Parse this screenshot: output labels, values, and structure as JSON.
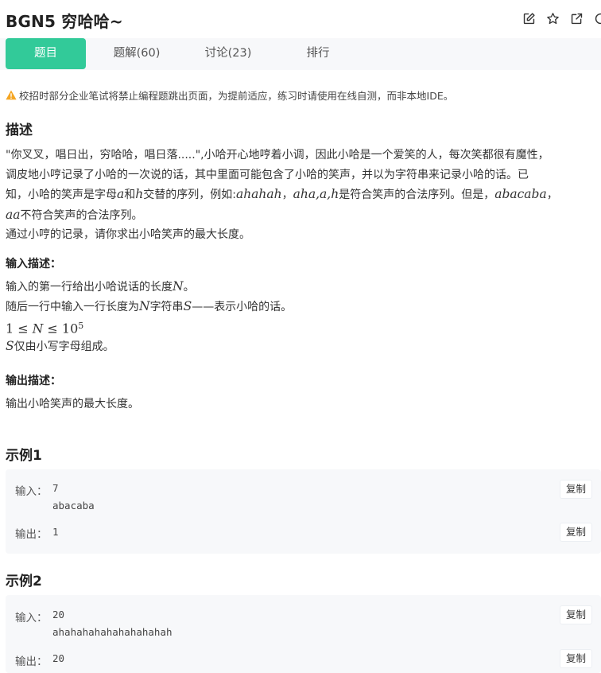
{
  "header": {
    "title": "BGN5  穷哈哈~",
    "icons": [
      "edit-icon",
      "star-icon",
      "share-icon",
      "more-icon"
    ]
  },
  "tabs": [
    {
      "label": "题目",
      "active": true
    },
    {
      "label": "题解(60)",
      "active": false
    },
    {
      "label": "讨论(23)",
      "active": false
    },
    {
      "label": "排行",
      "active": false
    }
  ],
  "notice": "校招时部分企业笔试将禁止编程题跳出页面，为提前适应，练习时请使用在线自测，而非本地IDE。",
  "description": {
    "heading": "描述",
    "l1": "\"你叉叉，唱日出，穷哈哈，唱日落.....\",小哈开心地哼着小调，因此小哈是一个爱笑的人，每次笑都很有魔性，",
    "l2": "调皮地小哼记录了小哈的一次说的话，其中里面可能包含了小哈的笑声，并以为字符串来记录小哈的话。已",
    "l3a": "知，小哈的笑声是字母",
    "l3m1": "a",
    "l3b": "和",
    "l3m2": "h",
    "l3c": "交替的序列，例如:",
    "l3m3": "ahahah",
    "l3d": "，",
    "l3m4": "aha",
    "l3e": ",",
    "l3m5": "a",
    "l3f": ",",
    "l3m6": "h",
    "l3g": "是符合笑声的合法序列。但是，",
    "l3m7": "abacaba",
    "l3h": "，",
    "l4m1": "aa",
    "l4a": "不符合笑声的合法序列。",
    "l5": "通过小哼的记录，请你求出小哈笑声的最大长度。"
  },
  "input_desc": {
    "heading": "输入描述：",
    "r1a": "输入的第一行给出小哈说话的长度",
    "r1m": "N",
    "r1b": "。",
    "r2a": "随后一行中输入一行长度为",
    "r2m1": "N",
    "r2b": "字符串",
    "r2m2": "S",
    "r2c": "——表示小哈的话。",
    "r3m1": "1",
    "r3op1": " ≤ ",
    "r3m2": "N",
    "r3op2": " ≤ ",
    "r3m3": "10",
    "r3sup": "5",
    "r4m": "S",
    "r4a": "仅由小写字母组成。"
  },
  "output_desc": {
    "heading": "输出描述：",
    "text": "输出小哈笑声的最大长度。"
  },
  "examples": [
    {
      "heading": "示例1",
      "input_label": "输入：",
      "input_line1": "7",
      "input_line2": "abacaba",
      "output_label": "输出：",
      "output": "1",
      "copy_label": "复制"
    },
    {
      "heading": "示例2",
      "input_label": "输入：",
      "input_line1": "20",
      "input_line2": "ahahahahahahahahahah",
      "output_label": "输出：",
      "output": "20",
      "copy_label": "复制"
    }
  ],
  "colors": {
    "accent": "#32ca99",
    "warning": "#f5a623",
    "panel": "#f7f8fa"
  }
}
